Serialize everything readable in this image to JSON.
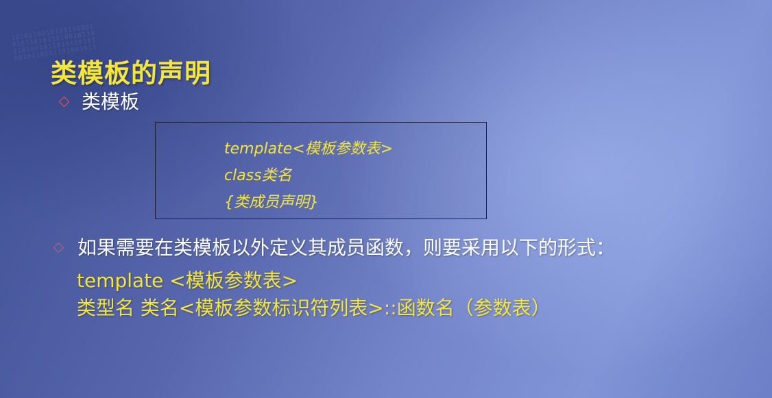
{
  "slide": {
    "title": "类模板的声明",
    "bullet1": "类模板",
    "code_box": {
      "line1": "template<模板参数表>",
      "line2": "class类名",
      "line3": "{类成员声明}"
    },
    "bullet2": "如果需要在类模板以外定义其成员函数，则要采用以下的形式：",
    "syntax_line1": "template <模板参数表>",
    "syntax_line2": "类型名 类名<模板参数标识符列表>::函数名（参数表）"
  },
  "colors": {
    "title": "#f5e63a",
    "bullet_marker": "#e05a5a",
    "body_text": "#ffffff",
    "code_text": "#f5e63a"
  },
  "icons": {
    "bullet_marker": "hollow-diamond"
  }
}
